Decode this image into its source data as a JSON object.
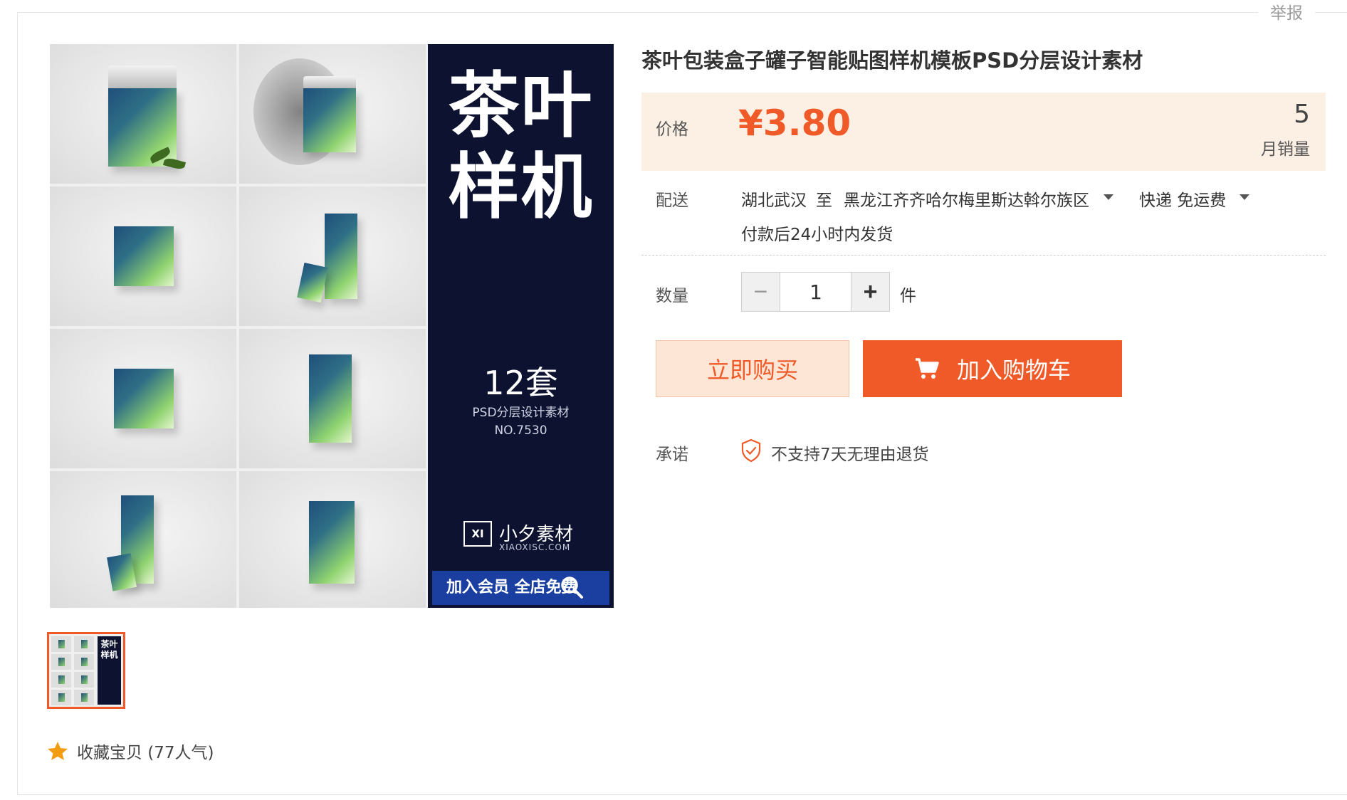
{
  "header": {
    "report_label": "举报"
  },
  "gallery": {
    "banner": {
      "title_line1": "茶叶",
      "title_line2": "样机",
      "count": "12套",
      "subtitle": "PSD分层设计素材",
      "number": "NO.7530",
      "brand_mark": "XI",
      "brand_name": "小夕素材",
      "brand_url": "XIAOXISC.COM",
      "member_text": "加入会员 全店免费"
    },
    "thumbnail": {
      "title_line1": "茶叶",
      "title_line2": "样机"
    },
    "zoom_icon": "magnifier-icon"
  },
  "favorite": {
    "icon": "star-icon",
    "label": "收藏宝贝 (77人气)",
    "color": "#f39c12"
  },
  "product": {
    "title": "茶叶包装盒子罐子智能贴图样机模板PSD分层设计素材",
    "price_label": "价格",
    "price": "¥3.80",
    "monthly_sales": "5",
    "monthly_sales_label": "月销量"
  },
  "shipping": {
    "label": "配送",
    "from": "湖北武汉",
    "to_connector": "至",
    "destination": "黑龙江齐齐哈尔梅里斯达斡尔族区",
    "method": "快递 免运费",
    "note": "付款后24小时内发货"
  },
  "quantity": {
    "label": "数量",
    "minus": "−",
    "plus": "+",
    "value": "1",
    "unit": "件"
  },
  "actions": {
    "buy_now": "立即购买",
    "add_to_cart": "加入购物车",
    "cart_icon": "cart-icon"
  },
  "promise": {
    "label": "承诺",
    "icon": "shield-check-icon",
    "text": "不支持7天无理由退货"
  },
  "colors": {
    "accent": "#f05a28",
    "price_bg": "#fcefe4",
    "buy_now_bg": "#fde6d6",
    "banner_bg": "#0c1230"
  }
}
